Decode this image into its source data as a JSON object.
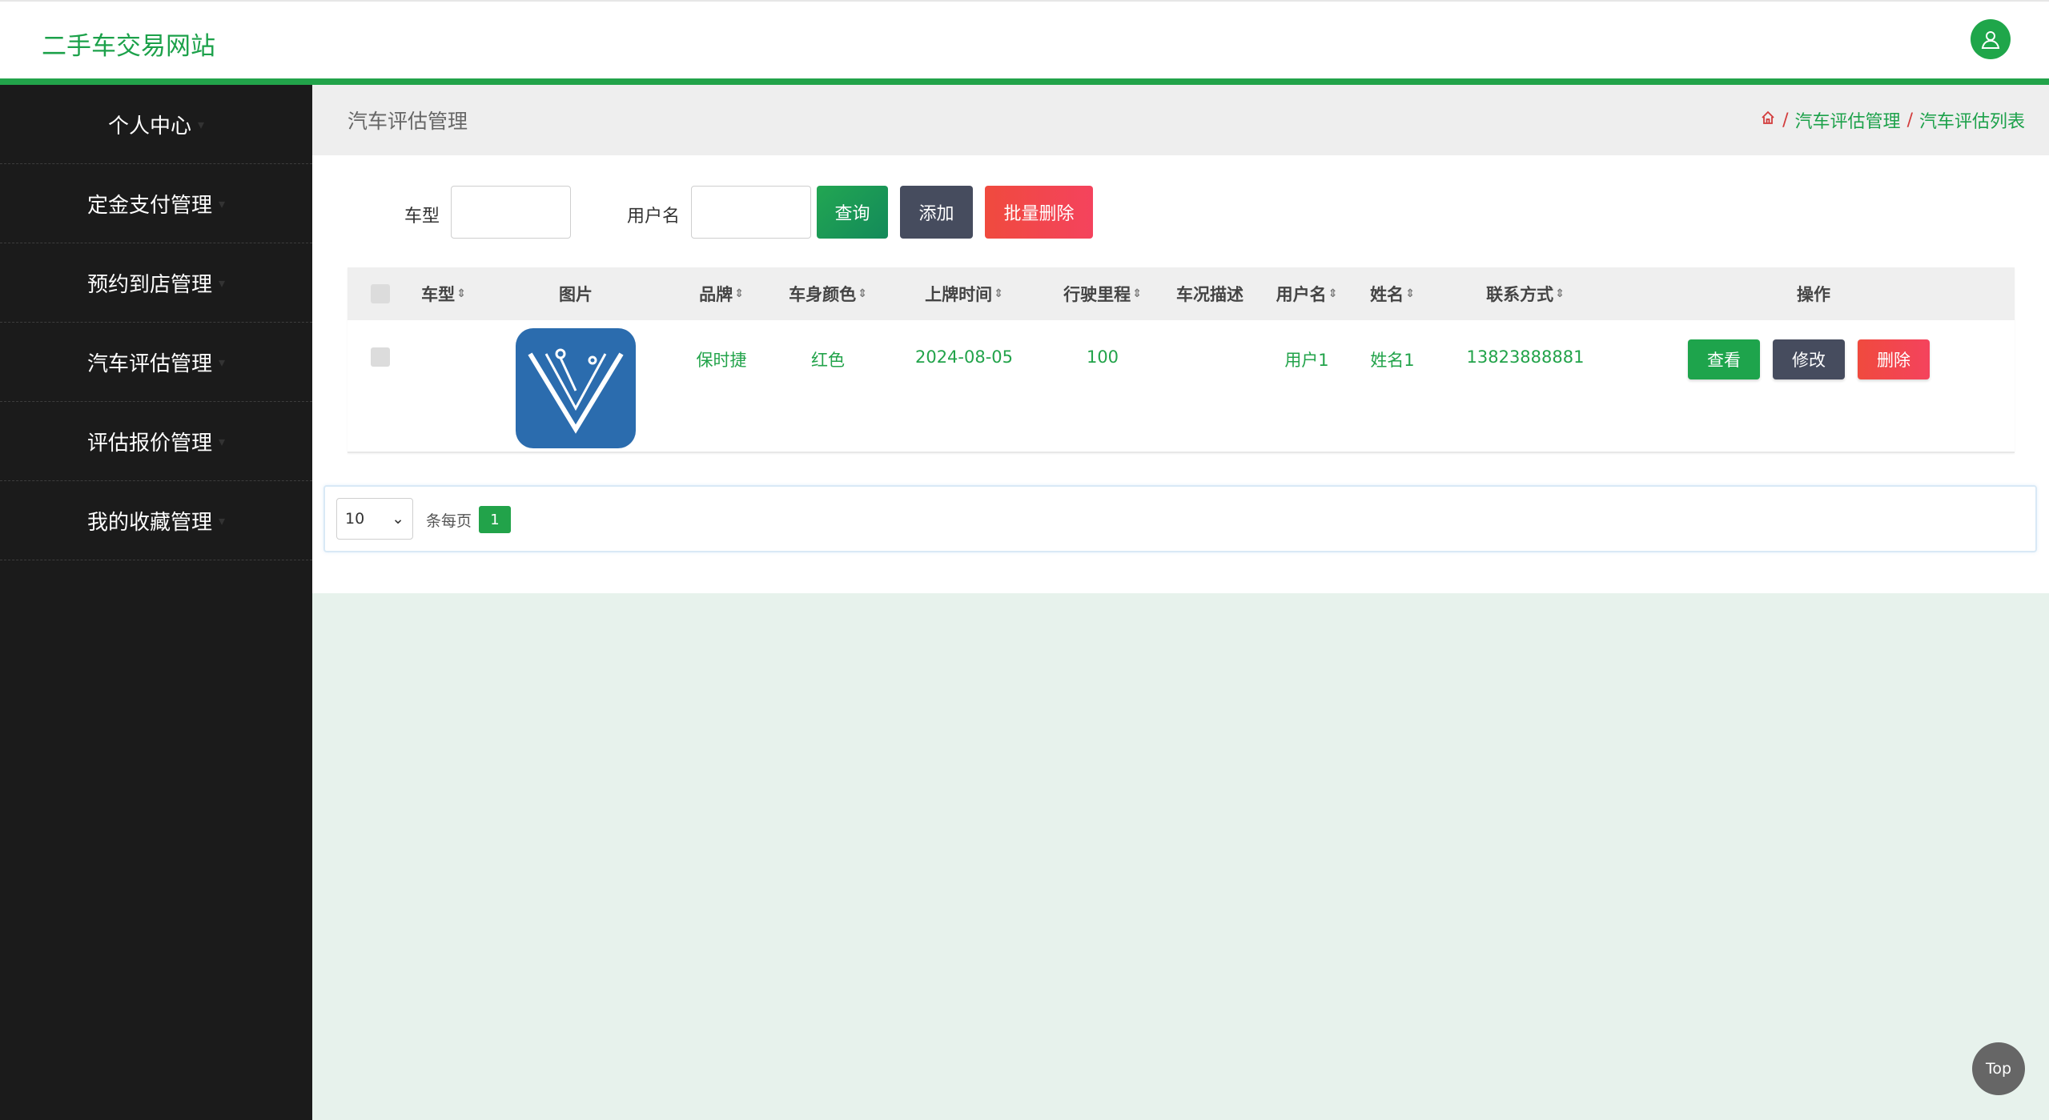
{
  "header": {
    "site_title": "二手车交易网站"
  },
  "sidebar": {
    "items": [
      {
        "label": "个人中心"
      },
      {
        "label": "定金支付管理"
      },
      {
        "label": "预约到店管理"
      },
      {
        "label": "汽车评估管理"
      },
      {
        "label": "评估报价管理"
      },
      {
        "label": "我的收藏管理"
      }
    ]
  },
  "page": {
    "title": "汽车评估管理",
    "breadcrumb": [
      "汽车评估管理",
      "汽车评估列表"
    ]
  },
  "search": {
    "car_type_label": "车型",
    "car_type_value": "",
    "username_label": "用户名",
    "username_value": "",
    "query_button": "查询",
    "add_button": "添加",
    "batch_delete_button": "批量删除"
  },
  "table": {
    "headers": [
      "车型",
      "图片",
      "品牌",
      "车身颜色",
      "上牌时间",
      "行驶里程",
      "车况描述",
      "用户名",
      "姓名",
      "联系方式",
      "操作"
    ],
    "rows": [
      {
        "car_type": "",
        "image": "car-logo-v",
        "brand": "保时捷",
        "color": "红色",
        "plate_date": "2024-08-05",
        "mileage": "100",
        "condition": "",
        "username": "用户1",
        "name": "姓名1",
        "contact": "13823888881",
        "actions": [
          "查看",
          "修改",
          "删除"
        ]
      }
    ]
  },
  "pagination": {
    "page_size": "10",
    "per_page_label": "条每页",
    "current_page": "1"
  },
  "back_to_top": "Top",
  "colors": {
    "brand_green": "#22a34a",
    "sidebar_bg": "#1b1b1b",
    "dark_button": "#464c5e",
    "red_button": "#f04545"
  }
}
